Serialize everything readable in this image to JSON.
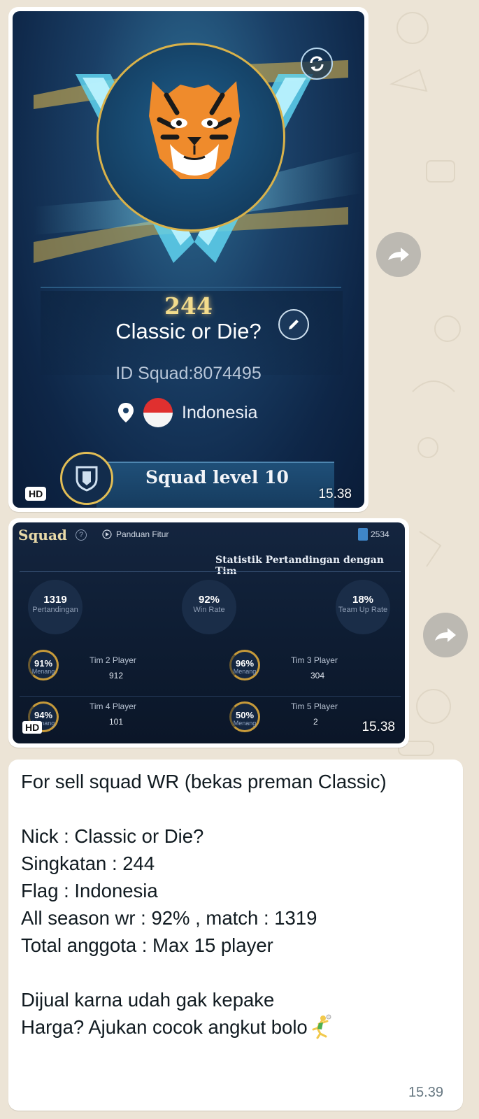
{
  "bubbles": [
    {
      "squad_profile": {
        "abbreviation": "244",
        "name": "Classic or Die?",
        "squad_id": "ID Squad:8074495",
        "country": "Indonesia",
        "level_text": "Squad level 10",
        "emblem_icon": "tiger-emblem-icon"
      },
      "hd_badge": "HD",
      "time": "15.38"
    },
    {
      "squad_stats": {
        "title": "Squad",
        "help_icon": "?",
        "guide_label": "Panduan Fitur",
        "coins": "2534",
        "heading": "Statistik Pertandingan dengan Tim",
        "summary": [
          {
            "value": "1319",
            "label": "Pertandingan"
          },
          {
            "value": "92%",
            "label": "Win Rate"
          },
          {
            "value": "18%",
            "label": "Team Up Rate"
          }
        ],
        "teams": [
          {
            "percent": "91%",
            "sub": "Menang",
            "label": "Tim 2 Player",
            "count": "912"
          },
          {
            "percent": "96%",
            "sub": "Menang",
            "label": "Tim 3 Player",
            "count": "304"
          },
          {
            "percent": "94%",
            "sub": "Menang",
            "label": "Tim 4 Player",
            "count": "101"
          },
          {
            "percent": "50%",
            "sub": "Menang",
            "label": "Tim 5 Player",
            "count": "2"
          }
        ]
      },
      "hd_badge": "HD",
      "time": "15.38"
    },
    {
      "text": "For sell squad WR (bekas preman Classic)\n\nNick : Classic or Die?\nSingkatan : 244\nFlag : Indonesia\nAll season wr : 92% , match : 1319\nTotal anggota : Max 15 player\n\nDijual karna udah gak kepake\nHarga? Ajukan cocok angkut bolo",
      "emoji": "handball-emoji-icon",
      "time": "15.39"
    }
  ],
  "colors": {
    "chat_background": "#ece4d6",
    "bubble": "#ffffff",
    "time_text": "#667781",
    "gold_accent": "#d9b24a"
  }
}
